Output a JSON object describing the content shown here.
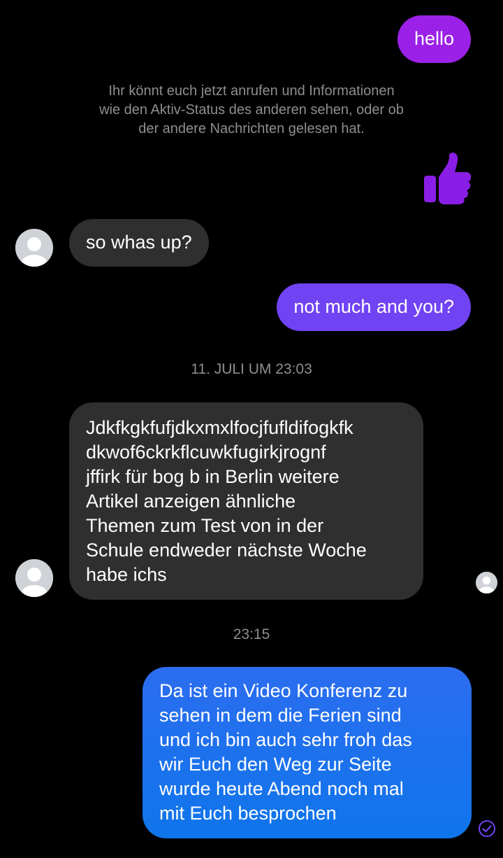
{
  "conversation": {
    "messages": [
      {
        "direction": "outgoing",
        "text": "hello"
      },
      {
        "direction": "incoming",
        "text": "so whas up?"
      },
      {
        "direction": "outgoing",
        "text": "not much and you?"
      },
      {
        "direction": "incoming",
        "text": "Jdkfkgkfufjdkxmxlfocjfufldifogkfk\ndkwof6ckrkflcuwkfugirkjrognf\njffirk für  bog b in  Berlin  weitere\nArtikel  anzeigen  ähnliche\nThemen zum Test von in der\nSchule endweder nächste Woche\nhabe ichs"
      },
      {
        "direction": "outgoing",
        "text": "Da ist ein Video Konferenz zu\nsehen in dem die Ferien sind\nund ich bin auch sehr froh das\nwir Euch den Weg zur Seite\nwurde heute Abend noch mal\nmit Euch besprochen"
      }
    ],
    "system_notice": "Ihr könnt euch jetzt anrufen und Informationen\nwie den Aktiv-Status des anderen sehen, oder ob\nder andere Nachrichten gelesen hat.",
    "timestamps": [
      "11. JULI UM 23:03",
      "23:15"
    ],
    "reaction_icon": "thumbs-up-icon",
    "read_receipt_icon": "avatar-seen-icon",
    "sent_status_icon": "check-circle-icon"
  },
  "colors": {
    "background": "#000000",
    "incoming_bubble": "#2f2f2f",
    "outgoing_purple": "#9b21e8",
    "outgoing_violet": "#7043f3",
    "outgoing_blue": "#1a6ff0",
    "thumbs_up": "#8a1ee6",
    "muted_text": "#8e8e93"
  }
}
